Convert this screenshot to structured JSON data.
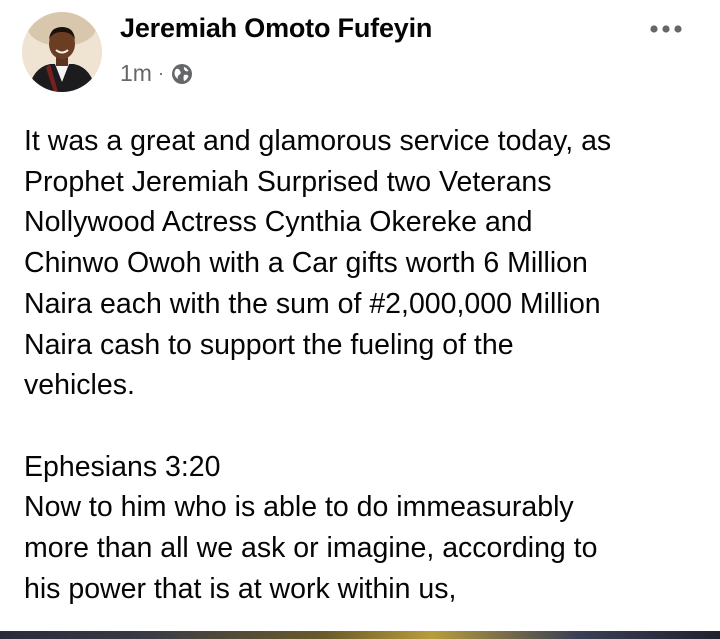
{
  "post": {
    "author": "Jeremiah Omoto Fufeyin",
    "timestamp": "1m",
    "separator": "·",
    "privacy_icon": "globe-icon",
    "more_icon": "more-options-icon",
    "body": "It was a great and glamorous service today, as\nProphet Jeremiah Surprised two Veterans\nNollywood Actress Cynthia Okereke and\nChinwo Owoh with a Car gifts worth 6 Million\nNaira each with the sum of #2,000,000 Million\nNaira cash to support the fueling of the\nvehicles.\n\nEphesians 3:20\nNow to him who is able to do immeasurably\nmore than all we ask or imagine, according to\nhis power that is at work within us,"
  },
  "colors": {
    "text_primary": "#050505",
    "text_secondary": "#65676b",
    "background": "#ffffff"
  }
}
